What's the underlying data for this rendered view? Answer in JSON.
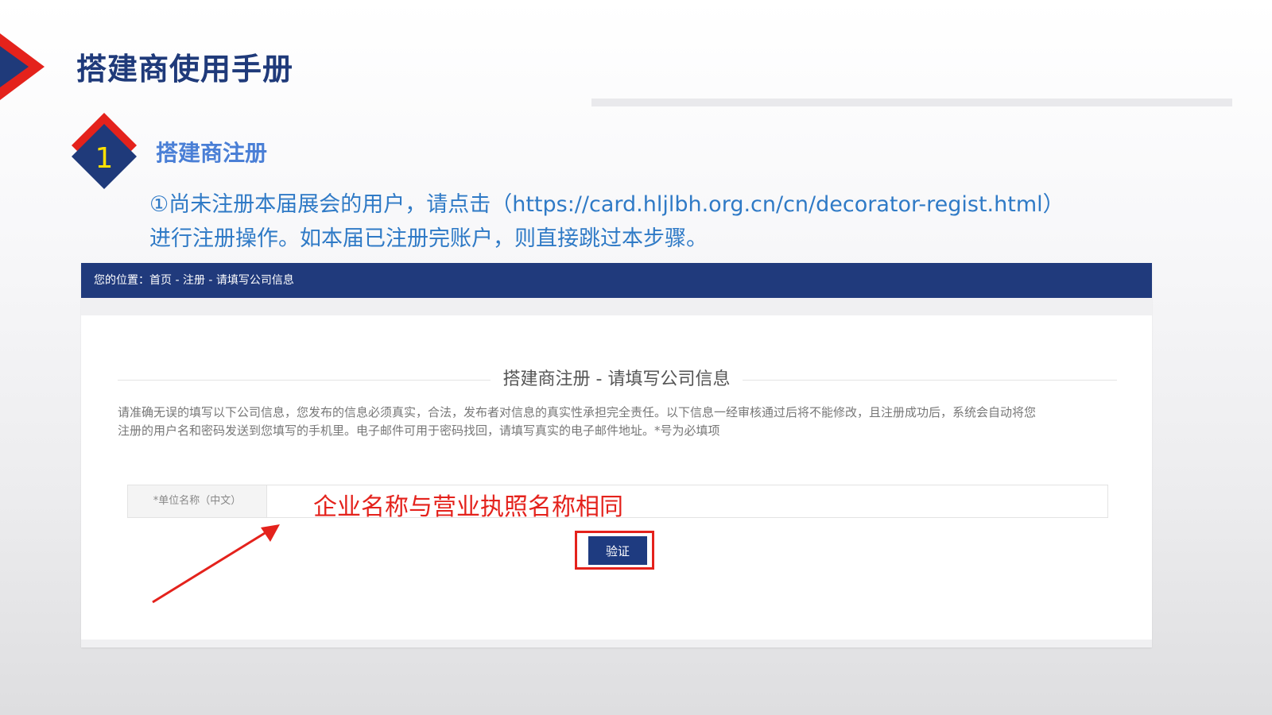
{
  "slide": {
    "title": "搭建商使用手册",
    "step_number": "1",
    "section_title": "搭建商注册",
    "instruction_line1": "①尚未注册本届展会的用户，请点击（https://card.hljlbh.org.cn/cn/decorator-regist.html）",
    "instruction_line2": "进行注册操作。如本届已注册完账户，则直接跳过本步骤。"
  },
  "screenshot": {
    "breadcrumb": "您的位置：首页 - 注册 - 请填写公司信息",
    "form_title": "搭建商注册 - 请填写公司信息",
    "description_line1": "请准确无误的填写以下公司信息，您发布的信息必须真实，合法，发布者对信息的真实性承担完全责任。以下信息一经审核通过后将不能修改，且注册成功后，系统会自动将您",
    "description_line2": "注册的用户名和密码发送到您填写的手机里。电子邮件可用于密码找回，请填写真实的电子邮件地址。*号为必填项",
    "company_name_label": "*单位名称（中文）",
    "company_name_value": "",
    "verify_button": "验证"
  },
  "annotation": {
    "note": "企业名称与营业执照名称相同",
    "color": "#e4221c"
  },
  "colors": {
    "title": "#1f3a7a",
    "accent_red": "#e4221c",
    "nav_blue": "#203a7c",
    "link_blue": "#2f7ac6",
    "badge_yellow": "#ffe100"
  }
}
